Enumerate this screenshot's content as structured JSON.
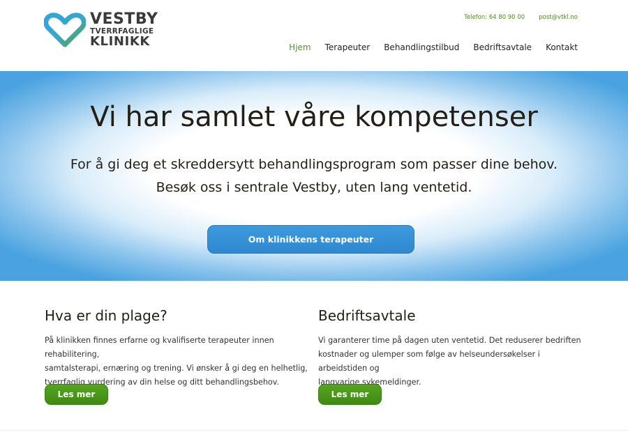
{
  "logo": {
    "line1": "VESTBY",
    "line2": "TVERRFAGLIGE",
    "line3": "KLINIKK"
  },
  "contact": {
    "phone": "Telefon: 64 80 90 00",
    "email": "post@vtkl.no"
  },
  "nav": [
    {
      "label": "Hjem",
      "active": true
    },
    {
      "label": "Terapeuter"
    },
    {
      "label": "Behandlingstilbud"
    },
    {
      "label": "Bedriftsavtale"
    },
    {
      "label": "Kontakt"
    }
  ],
  "hero": {
    "title": "Vi har samlet våre kompetenser",
    "sub1": "For å gi deg et skreddersytt behandlingsprogram som passer dine behov.",
    "sub2": "Besøk oss i sentrale Vestby, uten lang ventetid.",
    "button": "Om klinikkens terapeuter"
  },
  "sections": [
    {
      "title": "Hva er din plage?",
      "lines": [
        "På klinikken finnes erfarne og kvalifiserte terapeuter innen rehabilitering,",
        "samtalsterapi, ernæring og trening. Vi ønsker å gi deg en helhetlig,",
        "tverrfaglig vurdering av din helse og ditt behandlingsbehov."
      ],
      "button": "Les mer"
    },
    {
      "title": "Bedriftsavtale",
      "lines": [
        "Vi garanterer time på dagen uten ventetid. Det reduserer bedriften",
        "kostnader og ulemper som følge av helseundersøkelser i arbeidstiden og",
        "langvarige sykemeldinger."
      ],
      "button": "Les mer"
    }
  ],
  "colors": {
    "green": "#4e9a1e",
    "blue": "#3d9ade",
    "text": "#231f17"
  }
}
